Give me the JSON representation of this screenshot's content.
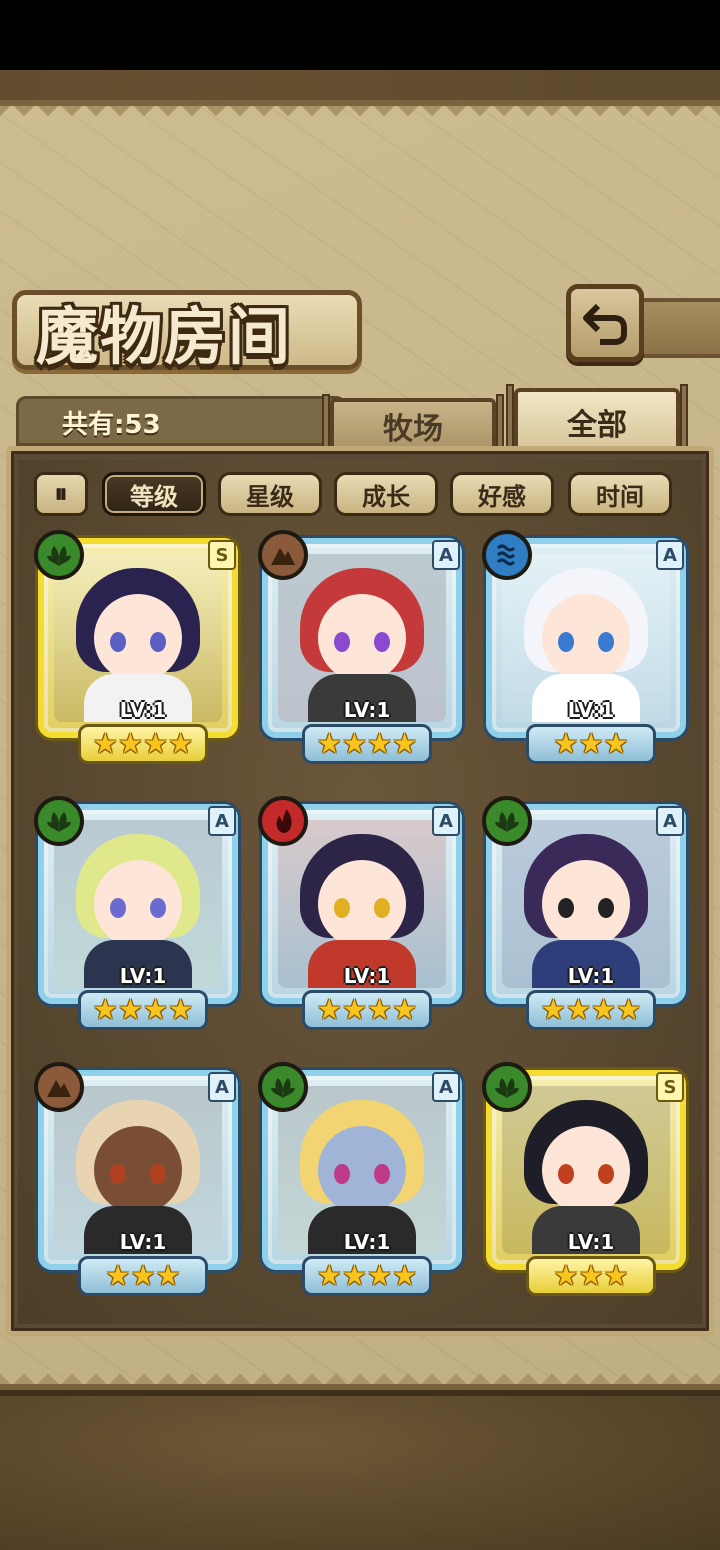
{
  "title": "魔物房间",
  "count_label": "共有:53",
  "tabs": [
    {
      "label": "牧场"
    },
    {
      "label": "全部"
    }
  ],
  "sort_toggle": "⏸",
  "filters": [
    "等级",
    "星级",
    "成长",
    "好感",
    "时间"
  ],
  "active_filter": "等级",
  "monsters": [
    {
      "element": "nature",
      "rank": "S",
      "level": "LV:1",
      "stars": 4,
      "colors": {
        "hair": "#2a2350",
        "skin": "#fde6d8",
        "eye": "#5b5fc4",
        "body": "#f2f2f2"
      }
    },
    {
      "element": "earth",
      "rank": "A",
      "level": "LV:1",
      "stars": 4,
      "colors": {
        "hair": "#c43a3a",
        "skin": "#fde6d8",
        "eye": "#8a4ad0",
        "body": "#3a3a3a"
      }
    },
    {
      "element": "water",
      "rank": "A",
      "level": "LV:1",
      "stars": 3,
      "colors": {
        "hair": "#f4f4fb",
        "skin": "#fde6d8",
        "eye": "#3a7ad0",
        "body": "#ffffff"
      }
    },
    {
      "element": "nature",
      "rank": "A",
      "level": "LV:1",
      "stars": 4,
      "colors": {
        "hair": "#dfe88a",
        "skin": "#fde6d8",
        "eye": "#6a6ad0",
        "body": "#2b3550"
      }
    },
    {
      "element": "fire",
      "rank": "A",
      "level": "LV:1",
      "stars": 4,
      "colors": {
        "hair": "#2c2548",
        "skin": "#fde6d8",
        "eye": "#e0b020",
        "body": "#c0392b"
      }
    },
    {
      "element": "nature",
      "rank": "A",
      "level": "LV:1",
      "stars": 4,
      "colors": {
        "hair": "#3a2a5a",
        "skin": "#fde6d8",
        "eye": "#222222",
        "body": "#2e3e7a"
      }
    },
    {
      "element": "earth",
      "rank": "A",
      "level": "LV:1",
      "stars": 3,
      "colors": {
        "hair": "#e8d4b0",
        "skin": "#7a4e34",
        "eye": "#b04020",
        "body": "#2a2a2a"
      }
    },
    {
      "element": "nature",
      "rank": "A",
      "level": "LV:1",
      "stars": 4,
      "colors": {
        "hair": "#f2d472",
        "skin": "#9fb4d6",
        "eye": "#c03a8a",
        "body": "#2a2a2a"
      }
    },
    {
      "element": "nature",
      "rank": "S",
      "level": "LV:1",
      "stars": 3,
      "colors": {
        "hair": "#1e1e28",
        "skin": "#fde6d8",
        "eye": "#c04020",
        "body": "#3a3a3a"
      }
    }
  ]
}
